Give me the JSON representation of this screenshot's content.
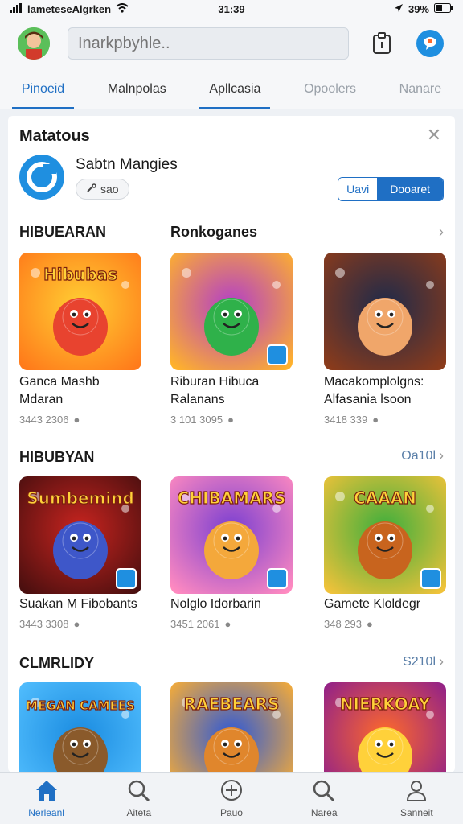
{
  "status": {
    "carrier": "lameteseAlgrken",
    "time": "31:39",
    "battery": "39%"
  },
  "search": {
    "placeholder": "Inarkpbyhle.."
  },
  "tabs": [
    {
      "label": "Pinoeid"
    },
    {
      "label": "Malnpolas"
    },
    {
      "label": "Apllcasia"
    },
    {
      "label": "Opoolers"
    },
    {
      "label": "Nanare"
    }
  ],
  "promo": {
    "title": "Matatous",
    "app_name": "Sabtn Mangies",
    "chip": "sao",
    "btn_secondary": "Uavi",
    "btn_primary": "Dooaret"
  },
  "sections": [
    {
      "title": "HIBUEARAN",
      "title2": "Ronkoganes",
      "link": "",
      "games": [
        {
          "name": "Ganca Mashb",
          "name2": "Mdaran",
          "meta": "3443 2306"
        },
        {
          "name": "Riburan Hibuca",
          "name2": "Ralanans",
          "meta": "3 101 3095"
        },
        {
          "name": "Macakomplolgns:",
          "name2": "Alfasania lsoon",
          "meta": "3418 339"
        }
      ]
    },
    {
      "title": "HIBUBYAN",
      "link": "Oa10l",
      "games": [
        {
          "name": "Suakan M Fibobants",
          "meta": "3443 3308"
        },
        {
          "name": "Nolglo Idorbarin",
          "meta": "3451 2061"
        },
        {
          "name": "Gamete Kloldegr",
          "meta": "348 293"
        }
      ]
    },
    {
      "title": "CLMRLIDY",
      "link": "S210l",
      "games": [
        {
          "name": ""
        },
        {
          "name": ""
        },
        {
          "name": ""
        }
      ]
    }
  ],
  "tile_art": [
    {
      "label": "Hibubas",
      "bg1": "#ffcf33",
      "bg2": "#ff7a1a",
      "fg": "#e8432f"
    },
    {
      "label": "",
      "bg1": "#b23ec9",
      "bg2": "#ffb22b",
      "fg": "#2fb14a"
    },
    {
      "label": "",
      "bg1": "#1e2a4a",
      "bg2": "#8b3b1b",
      "fg": "#f0a66a"
    },
    {
      "label": "Sumbemind",
      "bg1": "#c8241f",
      "bg2": "#4a0f0f",
      "fg": "#3e57c9"
    },
    {
      "label": "CHIBAMARS",
      "bg1": "#7a3fd1",
      "bg2": "#ff8ac0",
      "fg": "#f4a83b"
    },
    {
      "label": "CAAAN",
      "bg1": "#3cae3c",
      "bg2": "#f0c23a",
      "fg": "#c8641e"
    },
    {
      "label": "MEGAN CAMEES",
      "bg1": "#1a8be0",
      "bg2": "#54c0ff",
      "fg": "#8a5a2b"
    },
    {
      "label": "RAEBEARS",
      "bg1": "#2c58d8",
      "bg2": "#ffb030",
      "fg": "#e0862c"
    },
    {
      "label": "NIERKOAY",
      "bg1": "#ff6a2a",
      "bg2": "#8a1c8f",
      "fg": "#ffd13a"
    }
  ],
  "nav": [
    {
      "label": "Nerleanl",
      "icon": "home-icon"
    },
    {
      "label": "Aiteta",
      "icon": "search-icon"
    },
    {
      "label": "Pauo",
      "icon": "plus-circle-icon"
    },
    {
      "label": "Narea",
      "icon": "search-icon"
    },
    {
      "label": "Sanneit",
      "icon": "person-icon"
    }
  ]
}
